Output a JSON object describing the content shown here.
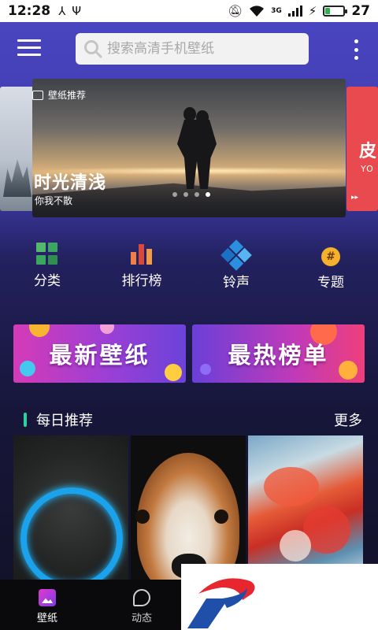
{
  "status_bar": {
    "time": "12:28",
    "network": "3G",
    "battery_percent": "27",
    "battery_level": 0.27,
    "icons": [
      "usb-icon",
      "usb-debug-icon",
      "mute-icon",
      "wifi-icon",
      "signal-icon",
      "charging-icon",
      "battery-icon"
    ]
  },
  "header": {
    "search_placeholder": "搜索高清手机壁纸",
    "icons": [
      "menu-icon",
      "search-icon",
      "more-vertical-icon"
    ]
  },
  "banner": {
    "badge": "壁纸推荐",
    "title": "时光清浅",
    "subtitle": "你我不散",
    "right_peek_text": "皮",
    "right_peek_sub": "YO",
    "page_count": 4,
    "active_page": 4
  },
  "quick_nav": [
    {
      "label": "分类",
      "icon": "category-grid-icon"
    },
    {
      "label": "排行榜",
      "icon": "ranking-bars-icon"
    },
    {
      "label": "铃声",
      "icon": "ringtone-icon"
    },
    {
      "label": "专题",
      "icon": "topic-hash-icon"
    }
  ],
  "promos": {
    "left": "最新壁纸",
    "right": "最热榜单"
  },
  "daily": {
    "title": "每日推荐",
    "more": "更多"
  },
  "tabs": [
    {
      "label": "壁纸",
      "icon": "wallpaper-tab-icon",
      "active": true
    },
    {
      "label": "动态",
      "icon": "feed-tab-icon",
      "active": false
    }
  ],
  "colors": {
    "header_bg": "#4b46c4",
    "accent_green": "#2fd0a0",
    "promo_left": "#d43bb6",
    "promo_right": "#ee3f7c",
    "logo_red": "#e8262f",
    "logo_blue": "#1f4fa8"
  }
}
